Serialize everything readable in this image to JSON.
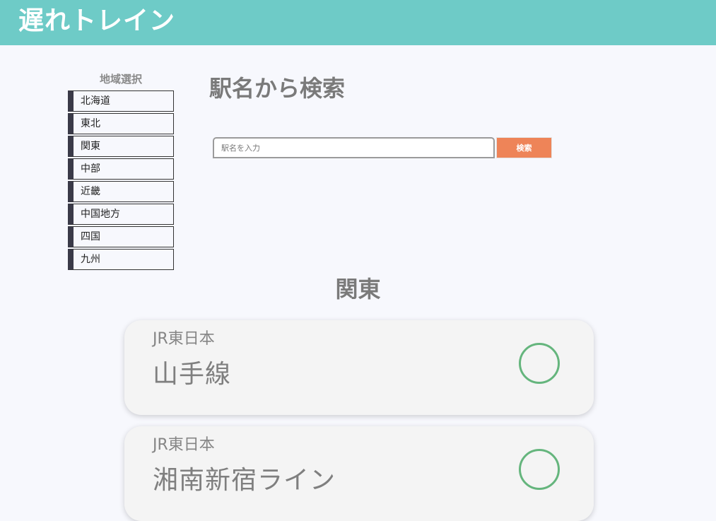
{
  "header": {
    "title": "遅れトレイン"
  },
  "sidebar": {
    "title": "地域選択",
    "regions": [
      {
        "label": "北海道"
      },
      {
        "label": "東北"
      },
      {
        "label": "関東"
      },
      {
        "label": "中部"
      },
      {
        "label": "近畿"
      },
      {
        "label": "中国地方"
      },
      {
        "label": "四国"
      },
      {
        "label": "九州"
      }
    ]
  },
  "search": {
    "title": "駅名から検索",
    "placeholder": "駅名を入力",
    "button_label": "検索"
  },
  "main": {
    "region_title": "関東",
    "lines": [
      {
        "company": "JR東日本",
        "name": "山手線",
        "status_icon": "circle-icon"
      },
      {
        "company": "JR東日本",
        "name": "湘南新宿ライン",
        "status_icon": "circle-icon"
      }
    ]
  },
  "colors": {
    "header": "#6ecbc7",
    "search_button": "#ee8458",
    "status_ok": "#65b57d",
    "sidebar_accent": "#3a3a48"
  }
}
